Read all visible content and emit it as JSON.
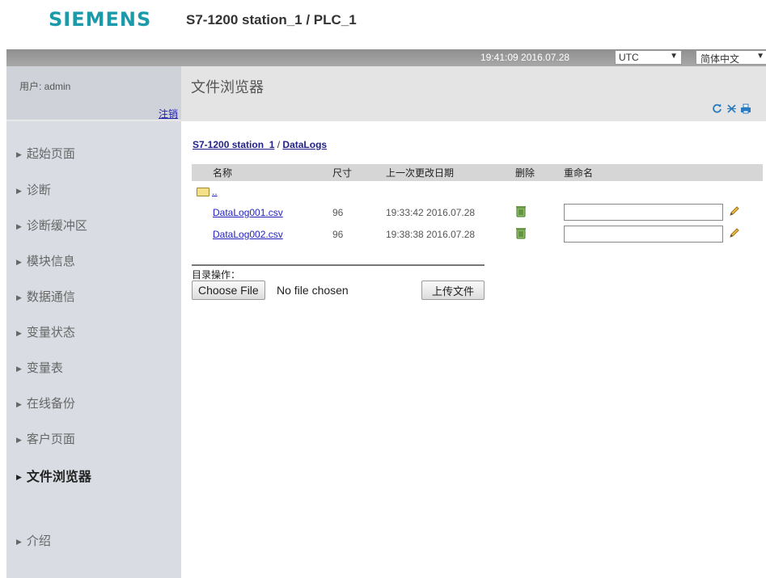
{
  "header": {
    "logo": "SIEMENS",
    "station_title": "S7-1200 station_1 / PLC_1"
  },
  "topbar": {
    "time": "19:41:09  2016.07.28",
    "timezone": "UTC",
    "language": "简体中文"
  },
  "sidebar": {
    "user_label": "用户:  admin",
    "logout": "注销",
    "items": [
      {
        "label": "起始页面"
      },
      {
        "label": "诊断"
      },
      {
        "label": "诊断缓冲区"
      },
      {
        "label": "模块信息"
      },
      {
        "label": "数据通信"
      },
      {
        "label": "变量状态"
      },
      {
        "label": "变量表"
      },
      {
        "label": "在线备份"
      },
      {
        "label": "客户页面"
      },
      {
        "label": "文件浏览器"
      },
      {
        "label": "介绍"
      }
    ],
    "active_index": 9
  },
  "main": {
    "title": "文件浏览器",
    "breadcrumb": {
      "station": "S7-1200 station_1",
      "separator": " / ",
      "folder": "DataLogs"
    },
    "table": {
      "headers": [
        "名称",
        "尺寸",
        "上一次更改日期",
        "删除",
        "重命名"
      ],
      "up_link": "..",
      "rows": [
        {
          "name": "DataLog001.csv",
          "size": "96",
          "modified": "19:33:42  2016.07.28",
          "rename": ""
        },
        {
          "name": "DataLog002.csv",
          "size": "96",
          "modified": "19:38:38  2016.07.28",
          "rename": ""
        }
      ]
    },
    "dir_ops_label": "目录操作：",
    "choose_file": "Choose File",
    "no_file": "No file chosen",
    "upload": "上传文件"
  },
  "colors": {
    "brand": "#1b9aaa",
    "sidebar_bg": "#d9dde3",
    "topbar_bg": "#9b9b9b",
    "link": "#2222bb"
  },
  "icons": [
    "refresh-icon",
    "close-icon",
    "print-icon",
    "folder-icon",
    "trash-icon",
    "pencil-icon"
  ]
}
